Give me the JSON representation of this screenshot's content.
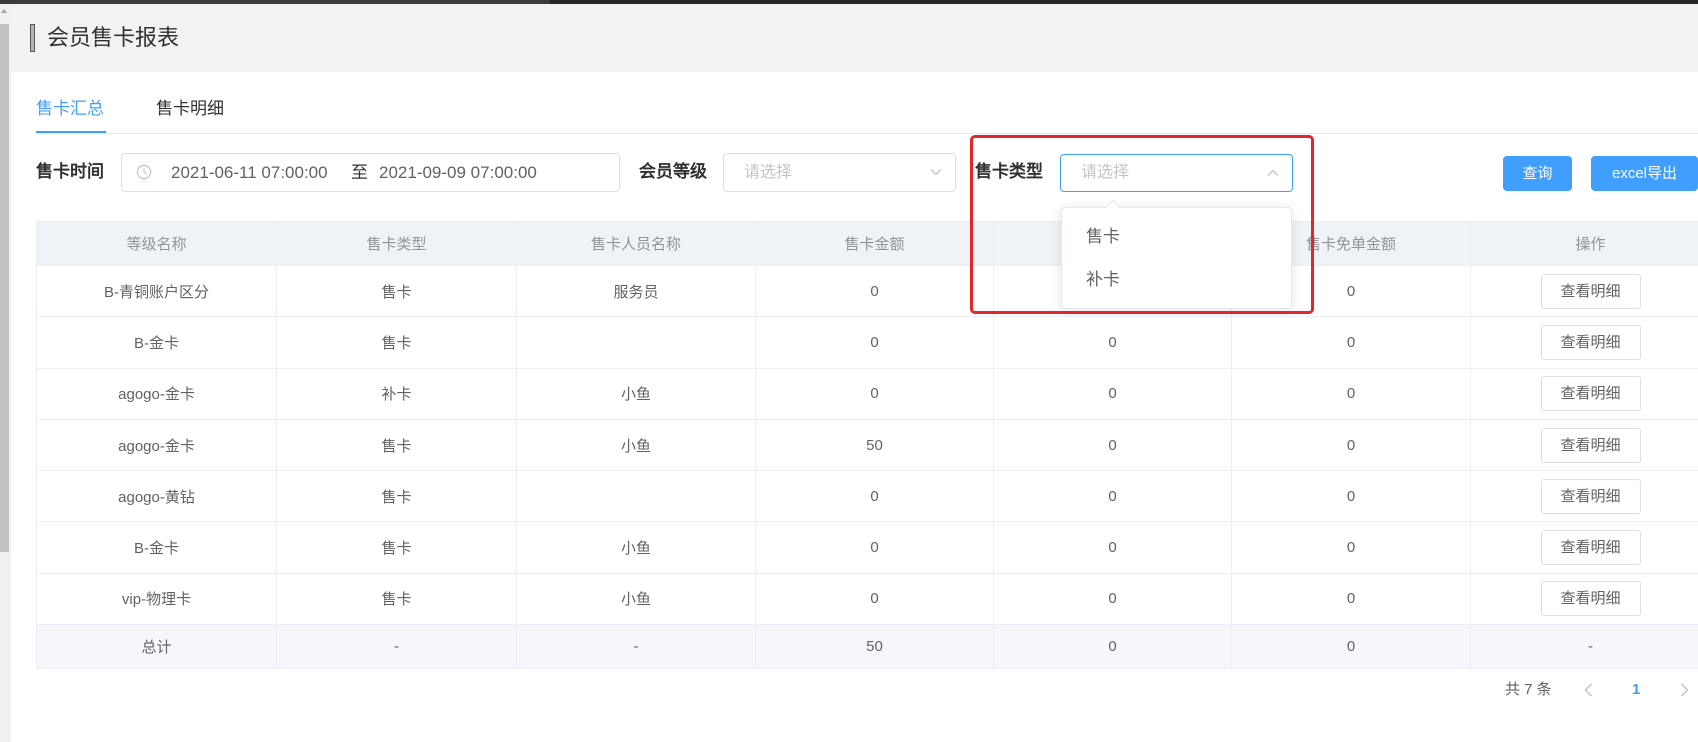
{
  "page": {
    "title": "会员售卡报表"
  },
  "tabs": [
    {
      "label": "售卡汇总",
      "active": true
    },
    {
      "label": "售卡明细",
      "active": false
    }
  ],
  "filters": {
    "sale_time": {
      "label": "售卡时间",
      "start": "2021-06-11 07:00:00",
      "separator": "至",
      "end": "2021-09-09 07:00:00",
      "icon": "clock-icon"
    },
    "member_level": {
      "label": "会员等级",
      "placeholder": "请选择",
      "icon": "chevron-down-icon"
    },
    "card_type": {
      "label": "售卡类型",
      "placeholder": "请选择",
      "icon": "chevron-up-icon",
      "dropdown_open": true,
      "options": [
        "售卡",
        "补卡"
      ]
    }
  },
  "actions": {
    "query": "查询",
    "export": "excel导出"
  },
  "table": {
    "columns": [
      "等级名称",
      "售卡类型",
      "售卡人员名称",
      "售卡金额",
      "",
      "售卡免单金额",
      "操作"
    ],
    "rows": [
      {
        "cells": [
          "B-青铜账户区分",
          "售卡",
          "服务员",
          "0",
          "",
          "0"
        ],
        "action": "查看明细"
      },
      {
        "cells": [
          "B-金卡",
          "售卡",
          "",
          "0",
          "0",
          "0"
        ],
        "action": "查看明细"
      },
      {
        "cells": [
          "agogo-金卡",
          "补卡",
          "小鱼",
          "0",
          "0",
          "0"
        ],
        "action": "查看明细"
      },
      {
        "cells": [
          "agogo-金卡",
          "售卡",
          "小鱼",
          "50",
          "0",
          "0"
        ],
        "action": "查看明细"
      },
      {
        "cells": [
          "agogo-黄钻",
          "售卡",
          "",
          "0",
          "0",
          "0"
        ],
        "action": "查看明细"
      },
      {
        "cells": [
          "B-金卡",
          "售卡",
          "小鱼",
          "0",
          "0",
          "0"
        ],
        "action": "查看明细"
      },
      {
        "cells": [
          "vip-物理卡",
          "售卡",
          "小鱼",
          "0",
          "0",
          "0"
        ],
        "action": "查看明细"
      }
    ],
    "total": [
      "总计",
      "-",
      "-",
      "50",
      "0",
      "0",
      "-"
    ]
  },
  "pagination": {
    "total_text": "共 7 条",
    "current_page": "1",
    "prev_icon": "chevron-left-icon",
    "next_icon": "chevron-right-icon"
  },
  "colors": {
    "accent": "#409eff",
    "annotation_outline": "#e3262b",
    "header_band": "#f2f2f2",
    "table_text": "#606266"
  }
}
